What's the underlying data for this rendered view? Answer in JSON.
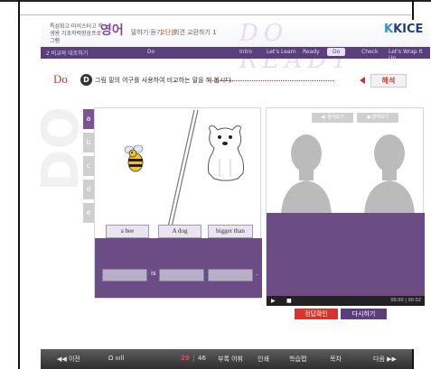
{
  "header": {
    "subject": "특성화고·마이스터고 학생용 기초학력향상프로그램",
    "brand": "영어",
    "crumbs": [
      "말하기·듣기 ",
      "2단원",
      " 의견 교환하기 1"
    ],
    "deco_text": "DO READY",
    "logo_prefix": "K",
    "logo_text": "KICE"
  },
  "nav": {
    "lesson": "2   비교와 대조하기",
    "section": "Do",
    "items": [
      "Intro",
      "Let's Learn",
      "Ready",
      "Do",
      "Check",
      "Let's Wrap It Up"
    ],
    "active": "Do"
  },
  "activity": {
    "heading": "Do",
    "badge": "D",
    "instruction": "그림 밑의 어구를 사용하여 비교하는 말을 해 봅시다.",
    "interpret_button": "해석"
  },
  "tabs": [
    "a",
    "b",
    "c",
    "d",
    "e"
  ],
  "active_tab": "a",
  "left_panel": {
    "words": [
      "a bee",
      "A dog",
      "bigger than"
    ],
    "sentence_mid": "is",
    "sentence_end": "."
  },
  "right_panel": {
    "listen_button": "◀) 들어보기",
    "speak_button": "● 말해보기",
    "time": "00:00 | 00:02"
  },
  "buttons": {
    "check": "정답확인",
    "retry": "다시하기"
  },
  "footer": {
    "prev": "◀◀ 이전",
    "page_current": "29",
    "page_total": "46",
    "appendix": "부록 어휘",
    "print": "인쇄",
    "study": "학습맵",
    "toc": "목차",
    "next": "다음 ▶▶"
  },
  "watermark": "DO",
  "colors": {
    "accent": "#5b3f7d",
    "panel": "#6b4c84",
    "heading": "#c23a3a"
  }
}
